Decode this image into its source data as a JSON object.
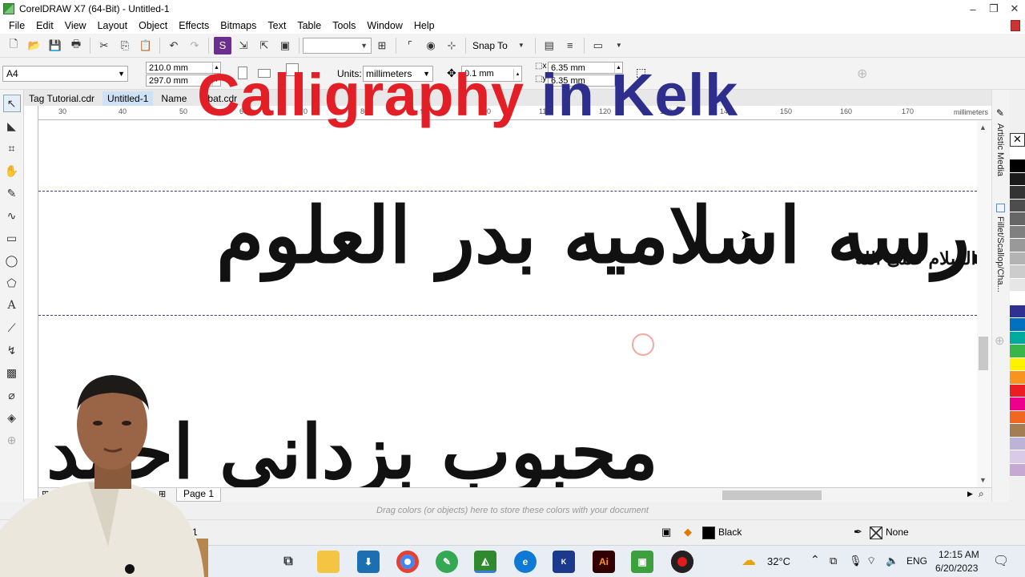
{
  "window": {
    "title": "CorelDRAW X7 (64-Bit) - Untitled-1",
    "controls": [
      "–",
      "❐",
      "✕"
    ]
  },
  "menu": [
    "File",
    "Edit",
    "View",
    "Layout",
    "Object",
    "Effects",
    "Bitmaps",
    "Text",
    "Table",
    "Tools",
    "Window",
    "Help"
  ],
  "toolbar": {
    "snap_to": "Snap To"
  },
  "propbar": {
    "page_size": "A4",
    "width": "210.0 mm",
    "height": "297.0 mm",
    "units_label": "Units:",
    "units_value": "millimeters",
    "nudge": "0.1 mm",
    "dup_x": "6.35 mm",
    "dup_y": "6.35 mm"
  },
  "overlay": {
    "part1": "Calligraphy",
    "part2": "in Kelk"
  },
  "doc_tabs": [
    "Tag Tutorial.cdr",
    "Untitled-1",
    "Name",
    "tabat.cdr"
  ],
  "ruler": {
    "numbers": [
      "30",
      "40",
      "50",
      "60",
      "70",
      "80",
      "90",
      "100",
      "110",
      "120",
      "130",
      "140",
      "150",
      "160",
      "170"
    ],
    "unit": "millimeters"
  },
  "canvas": {
    "line1": "مدرسه اسلامیه بدر العلوم",
    "small_text": "علیه السلام صلی الله",
    "line2": "محبوب بزدانی احمد"
  },
  "dockers": {
    "artistic_media": "Artistic Media",
    "fillet": "Fillet/Scallop/Cha..."
  },
  "palette": [
    "#ffffff",
    "#000000",
    "#1a1a1a",
    "#333333",
    "#4d4d4d",
    "#666666",
    "#808080",
    "#999999",
    "#b3b3b3",
    "#cccccc",
    "#e6e6e6",
    "#ffffff",
    "#2e3192",
    "#0071bc",
    "#00a99d",
    "#39b54a",
    "#fff200",
    "#f7931e",
    "#ed1c24",
    "#ec008c",
    "#f26522",
    "#a67c52",
    "#bdb3d9",
    "#d9cbe8",
    "#c7a8d4"
  ],
  "pagebar": {
    "page_label": "Page 1"
  },
  "colorwell_hint": "Drag colors (or objects) here to store these colors with your document",
  "status": {
    "left_text": "1",
    "fill_label": "Black",
    "outline_label": "None"
  },
  "taskbar": {
    "temperature": "32°C",
    "language": "ENG",
    "time": "12:15 AM",
    "date": "6/20/2023"
  }
}
